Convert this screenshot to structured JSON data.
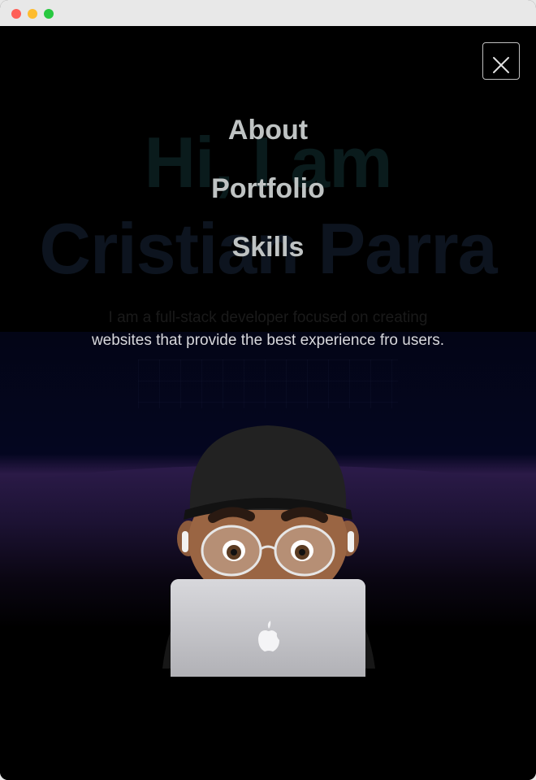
{
  "window": {
    "controls": [
      "close",
      "minimize",
      "maximize"
    ]
  },
  "hero": {
    "title_line1": "Hi, I am",
    "title_line2": "Cristian Parra",
    "subtitle_line1": "I am a full-stack developer focused on creating",
    "subtitle_line2": "websites that provide the best experience fro users."
  },
  "menu": {
    "items": [
      {
        "label": "About"
      },
      {
        "label": "Portfolio"
      },
      {
        "label": "Skills"
      }
    ],
    "close_icon": "close-icon"
  },
  "colors": {
    "menu_text": "#bfc3c3",
    "background": "#000000",
    "band_purple": "#2b1a47",
    "navy": "#040620"
  },
  "illustration": {
    "icon": "memoji-with-laptop-icon",
    "laptop_logo": "apple-logo-icon"
  }
}
